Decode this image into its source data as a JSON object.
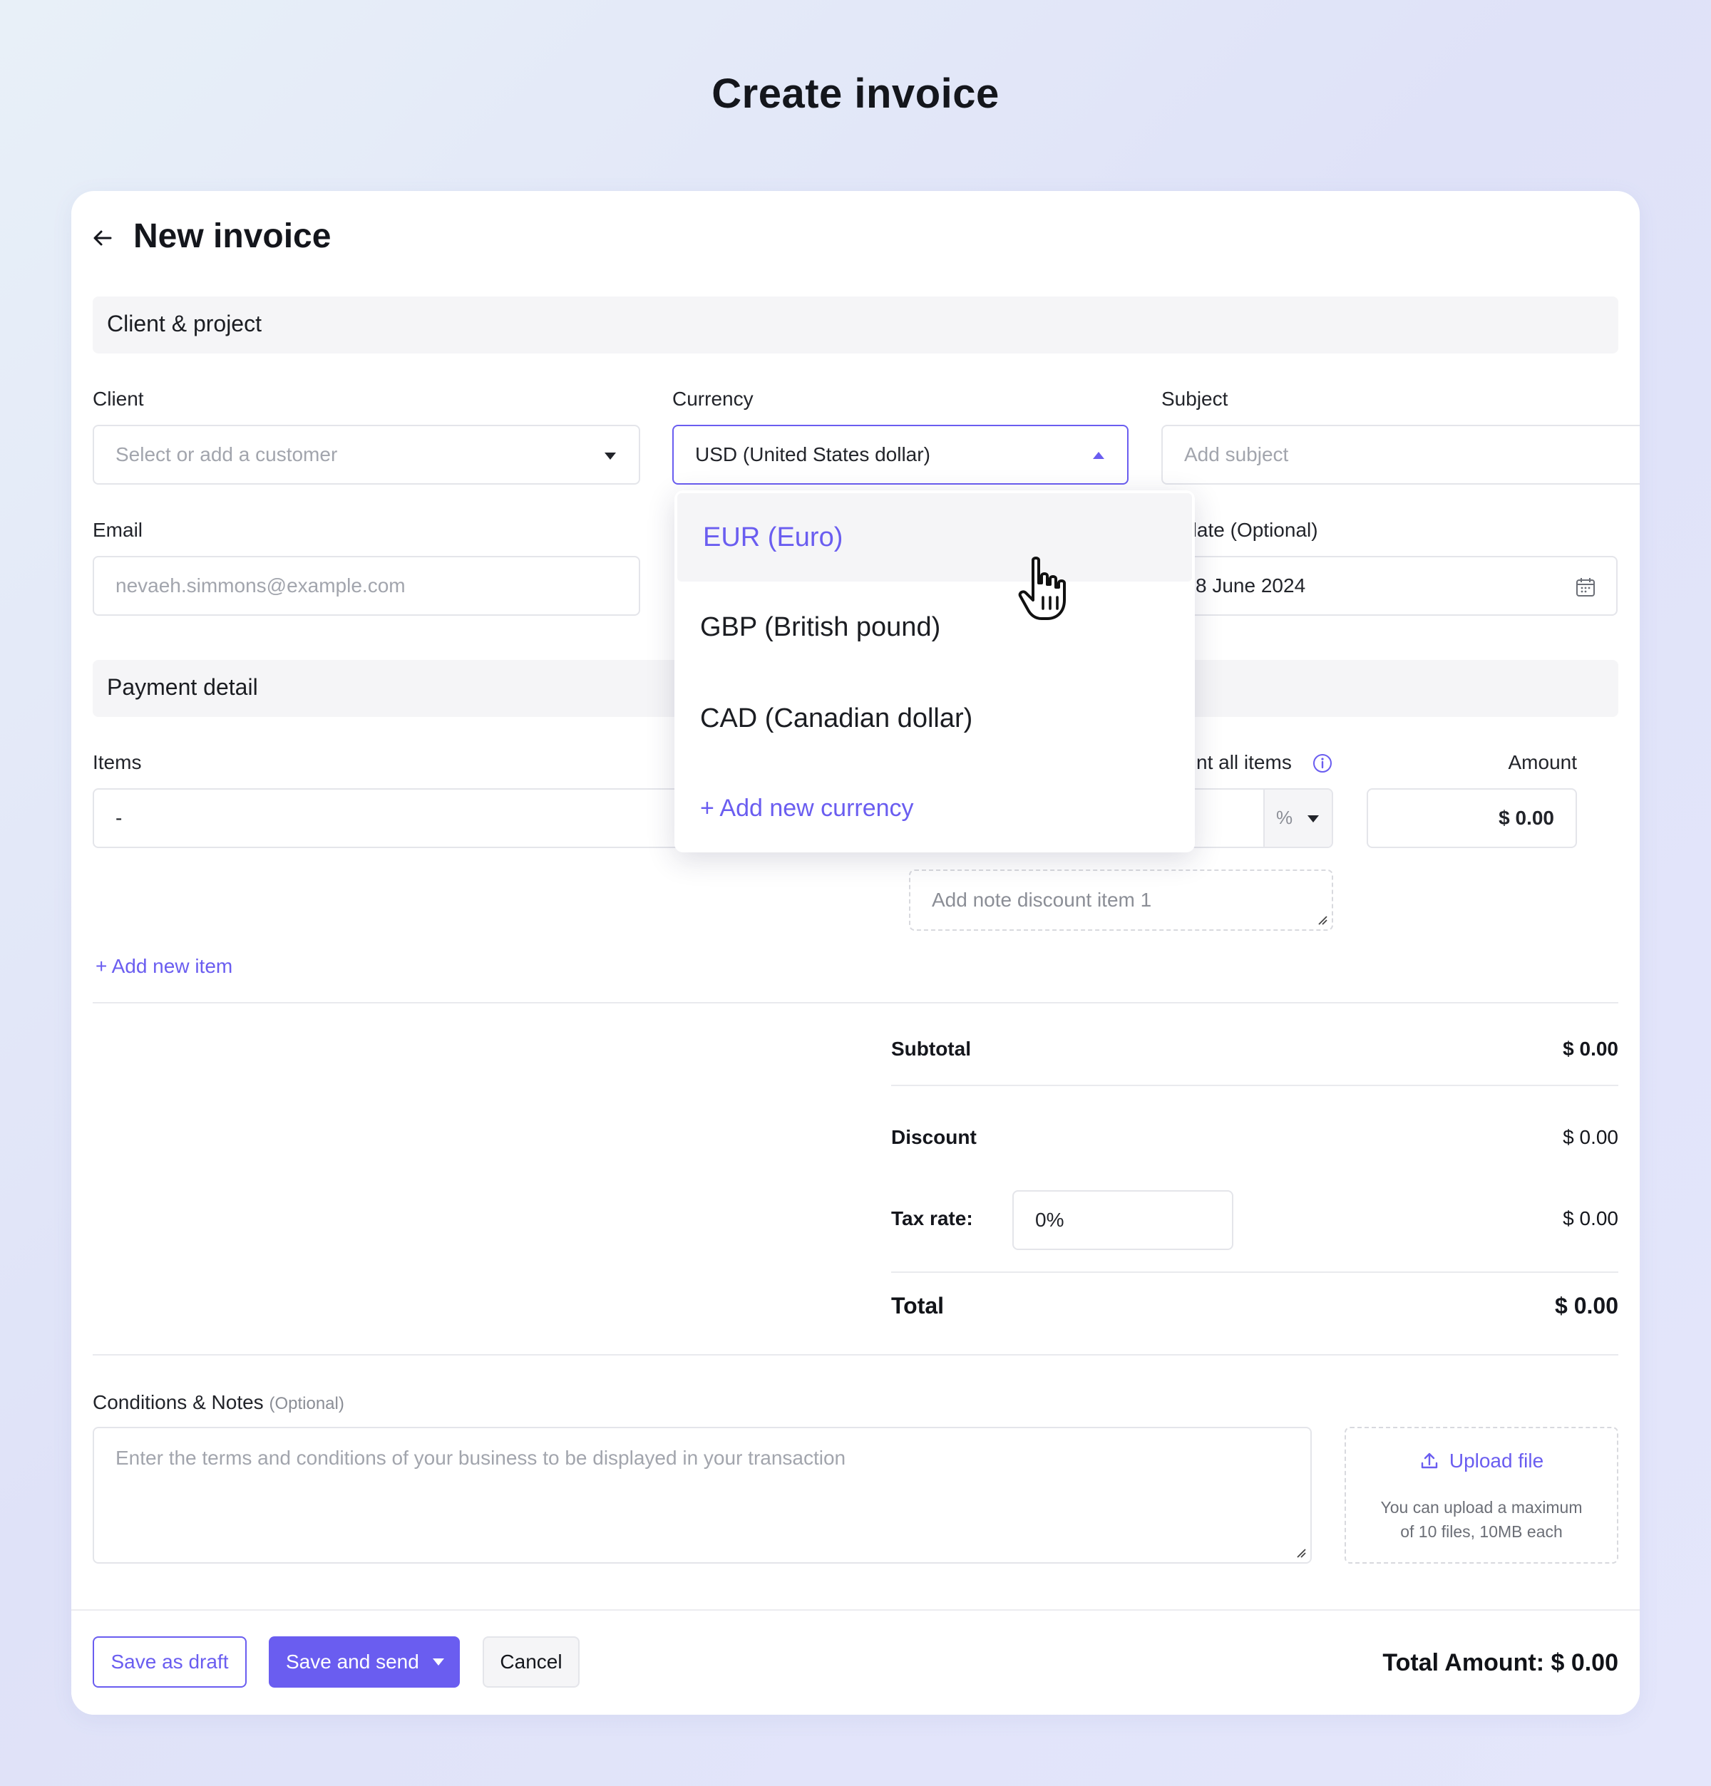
{
  "page": {
    "title": "Create invoice"
  },
  "card": {
    "title": "New invoice"
  },
  "sections": {
    "client_project": "Client & project",
    "payment_detail": "Payment detail"
  },
  "client": {
    "label": "Client",
    "placeholder": "Select or add a customer"
  },
  "currency": {
    "label": "Currency",
    "value": "USD (United States dollar)",
    "options": [
      "EUR (Euro)",
      "GBP (British pound)",
      "CAD (Canadian dollar)"
    ],
    "add_label": "+ Add new currency"
  },
  "subject": {
    "label": "Subject",
    "placeholder": "Add subject"
  },
  "email": {
    "label": "Email",
    "placeholder": "nevaeh.simmons@example.com"
  },
  "due_date": {
    "label": "e date (Optional)",
    "value": "8 June 2024"
  },
  "items": {
    "label": "Items",
    "value": "-",
    "discount_label": "nt all items",
    "discount_unit": "%",
    "amount_label": "Amount",
    "amount_value": "$ 0.00",
    "note_placeholder": "Add note discount item 1",
    "add_item": "+ Add new item"
  },
  "summary": {
    "subtotal_label": "Subtotal",
    "subtotal_value": "$ 0.00",
    "discount_label": "Discount",
    "discount_value": "$ 0.00",
    "tax_label": "Tax rate:",
    "tax_input": "0%",
    "tax_value": "$ 0.00",
    "total_label": "Total",
    "total_value": "$ 0.00"
  },
  "notes": {
    "label": "Conditions & Notes",
    "optional": "(Optional)",
    "placeholder": "Enter the terms and conditions of your business to be displayed in your transaction"
  },
  "upload": {
    "label": "Upload file",
    "hint_line1": "You can upload a maximum",
    "hint_line2": "of 10 files, 10MB each"
  },
  "footer": {
    "save_draft": "Save as draft",
    "save_send": "Save and send",
    "cancel": "Cancel",
    "total_amount": "Total Amount: $ 0.00"
  },
  "colors": {
    "accent": "#6a5df0",
    "section_bg": "#f5f5f7",
    "border": "#e4e5ea"
  }
}
